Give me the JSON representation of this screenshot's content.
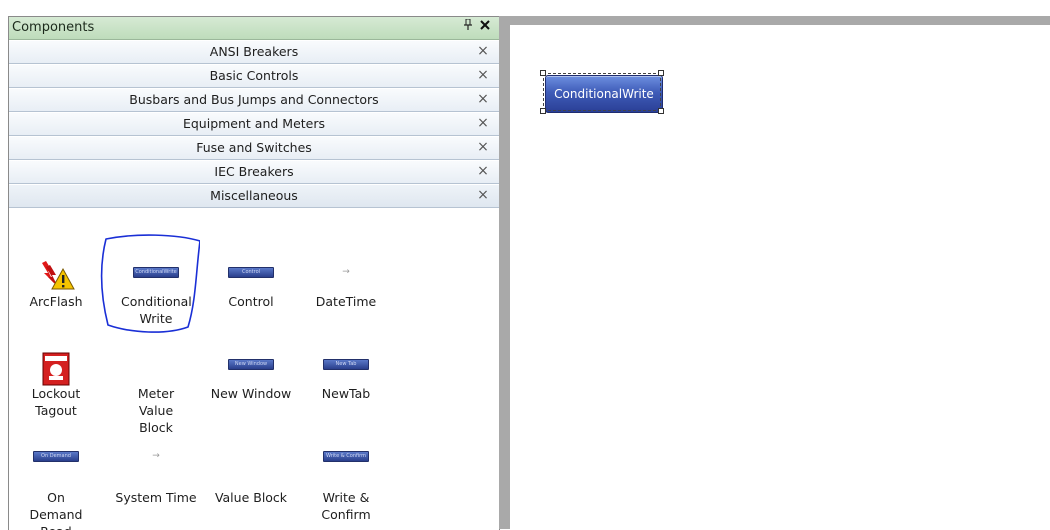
{
  "panel": {
    "title": "Components",
    "pin_icon": "pin-icon",
    "close_icon": "close-icon"
  },
  "categories": [
    {
      "label": "ANSI Breakers"
    },
    {
      "label": "Basic Controls"
    },
    {
      "label": "Busbars and Bus Jumps and Connectors"
    },
    {
      "label": "Equipment and Meters"
    },
    {
      "label": "Fuse and Switches"
    },
    {
      "label": "IEC Breakers"
    },
    {
      "label": "Miscellaneous"
    }
  ],
  "category_close_glyph": "×",
  "components": [
    {
      "label": "ArcFlash",
      "icon": "arcflash-warning-icon"
    },
    {
      "label": "Conditional Write",
      "icon": "button-icon",
      "icon_text": "ConditionalWrite"
    },
    {
      "label": "Control",
      "icon": "button-icon",
      "icon_text": "Control"
    },
    {
      "label": "DateTime",
      "icon": "dash-icon"
    },
    {
      "label": "Lockout Tagout",
      "icon": "lockout-tag-icon"
    },
    {
      "label": "Meter Value Block",
      "icon": "dash-icon"
    },
    {
      "label": "New Window",
      "icon": "button-icon",
      "icon_text": "New Window"
    },
    {
      "label": "NewTab",
      "icon": "button-icon",
      "icon_text": "New Tab"
    },
    {
      "label": "On Demand Read",
      "icon": "button-icon",
      "icon_text": "On Demand Read"
    },
    {
      "label": "System Time",
      "icon": "dash-icon"
    },
    {
      "label": "Value Block",
      "icon": "none"
    },
    {
      "label": "Write & Confirm",
      "icon": "button-icon",
      "icon_text": "Write & Confirm"
    }
  ],
  "canvas": {
    "selected_control_label": "ConditionalWrite"
  },
  "colors": {
    "header_green": "#c8e2c5",
    "button_blue": "#3f5cb8",
    "annotation_blue": "#1a2fd6"
  }
}
